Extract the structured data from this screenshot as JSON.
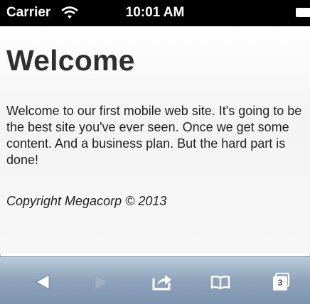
{
  "status_bar": {
    "carrier": "Carrier",
    "time": "10:01 AM"
  },
  "page": {
    "title": "Welcome",
    "body": "Welcome to our first mobile web site. It's going to be the best site you've ever seen. Once we get some content. And a business plan. But the hard part is done!",
    "copyright": "Copyright Megacorp © 2013"
  },
  "toolbar": {
    "tabs_count": "3",
    "icons": [
      "back-arrow-icon",
      "forward-arrow-icon",
      "share-icon",
      "bookmarks-icon",
      "tabs-icon"
    ],
    "forward_enabled": false
  },
  "colors": {
    "status_bar": "#000000",
    "toolbar_top": "#bccbdc",
    "toolbar_bottom": "#7e95b1",
    "text": "#222222"
  }
}
